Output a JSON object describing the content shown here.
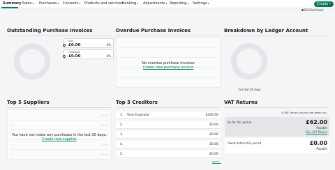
{
  "nav": {
    "items": [
      {
        "label": "Summary",
        "caret": false
      },
      {
        "label": "Sales",
        "caret": true
      },
      {
        "label": "Purchases",
        "caret": true
      },
      {
        "label": "Contacts",
        "caret": true
      },
      {
        "label": "Products and services",
        "caret": false
      },
      {
        "label": "Banking",
        "caret": true
      },
      {
        "label": "Adjustments",
        "caret": true
      },
      {
        "label": "Reporting",
        "caret": true
      },
      {
        "label": "Settings",
        "caret": true
      }
    ],
    "create_label": "Create",
    "chip_label": "Bill Purchases"
  },
  "outstanding": {
    "title": "Outstanding Purchase Invoices",
    "due": {
      "label": "DUE",
      "value": "£0.00",
      "pct": "0%"
    },
    "overdue": {
      "label": "OVERDUE",
      "value": "£0.00",
      "pct": "0%"
    }
  },
  "overdue_panel": {
    "title": "Overdue Purchase Invoices",
    "empty_message": "No overdue purchase invoices",
    "empty_link": "Create new purchase invoice"
  },
  "ledger": {
    "title": "Breakdown by Ledger Account",
    "caption": "For last 30 days"
  },
  "suppliers": {
    "title": "Top 5 Suppliers",
    "empty_message": "You have not made any purchases in the last 30 days.",
    "empty_link": "Create new supplier",
    "ghost_value": "£0.00"
  },
  "creditors": {
    "title": "Top 5 Creditors",
    "rows": [
      {
        "num": "1.",
        "name": "Vino Espanola",
        "amount": "£246.00"
      },
      {
        "num": "2.",
        "name": "",
        "amount": "£0.00"
      },
      {
        "num": "3.",
        "name": "",
        "amount": "£0.00"
      },
      {
        "num": "4.",
        "name": "",
        "amount": "£0.00"
      },
      {
        "num": "5.",
        "name": "",
        "amount": "£0.00"
      }
    ],
    "more_link": "more..."
  },
  "vat": {
    "title": "VAT Returns",
    "note": "A VAT return has not yet been run.",
    "so_far_label": "So far this period",
    "so_far_amount": "£62.00",
    "so_far_sub": "Payable",
    "run_link": "Run VAT Return",
    "before_label": "Owed before this period",
    "before_amount": "£0.00",
    "before_sub": "Payable"
  }
}
